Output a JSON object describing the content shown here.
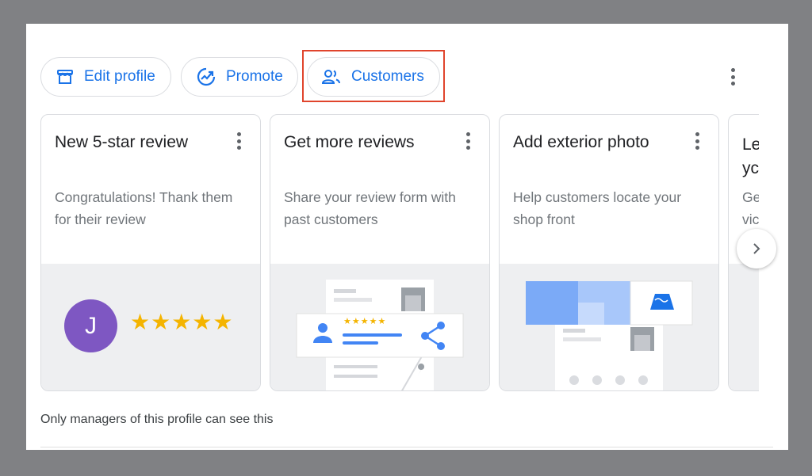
{
  "toolbar": {
    "chips": [
      {
        "label": "Edit profile",
        "icon": "storefront-icon"
      },
      {
        "label": "Promote",
        "icon": "trending-up-icon"
      },
      {
        "label": "Customers",
        "icon": "people-icon"
      }
    ],
    "more_icon": "more-vert-icon",
    "highlight_color": "#e0442c"
  },
  "cards": [
    {
      "title": "New 5-star review",
      "description": "Congratulations! Thank them for their review",
      "avatar_initial": "J",
      "stars": "★★★★★"
    },
    {
      "title": "Get more reviews",
      "description": "Share your review form with past customers",
      "mini_stars": "★★★★★"
    },
    {
      "title": "Add exterior photo",
      "description": "Help customers locate your shop front"
    },
    {
      "title": "Le yc",
      "description": "Ge vic"
    }
  ],
  "next_icon": "chevron-right-icon",
  "footnote": "Only managers of this profile can see this",
  "colors": {
    "accent": "#1a73e8",
    "star": "#f4b400",
    "avatar": "#7e57c2"
  }
}
